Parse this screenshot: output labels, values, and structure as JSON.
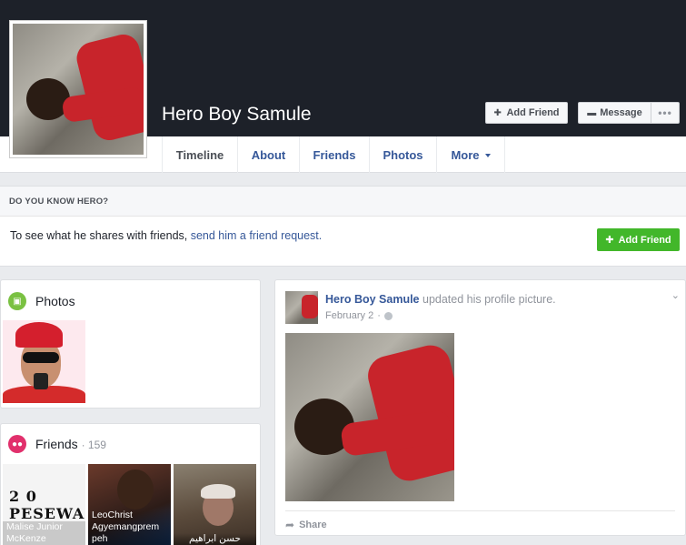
{
  "profile": {
    "name": "Hero Boy Samule"
  },
  "header_buttons": {
    "add_friend": "Add Friend",
    "message": "Message",
    "more": "•••"
  },
  "tabs": [
    {
      "label": "Timeline",
      "active": true
    },
    {
      "label": "About"
    },
    {
      "label": "Friends"
    },
    {
      "label": "Photos"
    },
    {
      "label": "More"
    }
  ],
  "know_box": {
    "heading": "DO YOU KNOW HERO?",
    "text_prefix": "To see what he shares with friends, ",
    "link": "send him a friend request.",
    "button": "Add Friend"
  },
  "photos": {
    "title": "Photos"
  },
  "friends": {
    "title": "Friends",
    "count": "159",
    "items": [
      {
        "name": "Malise Junior McKenze",
        "image_text": "2 0 PESEWAS"
      },
      {
        "name": "LeoChrist Agyemangprem peh"
      },
      {
        "name": "حسن ابراهيم"
      }
    ]
  },
  "post": {
    "author": "Hero Boy Samule",
    "action": "updated his profile picture.",
    "date": "February 2",
    "share": "Share"
  },
  "colors": {
    "cover": "#1d2129",
    "link": "#365899",
    "green_button": "#42b72a",
    "background": "#e9ebee"
  }
}
